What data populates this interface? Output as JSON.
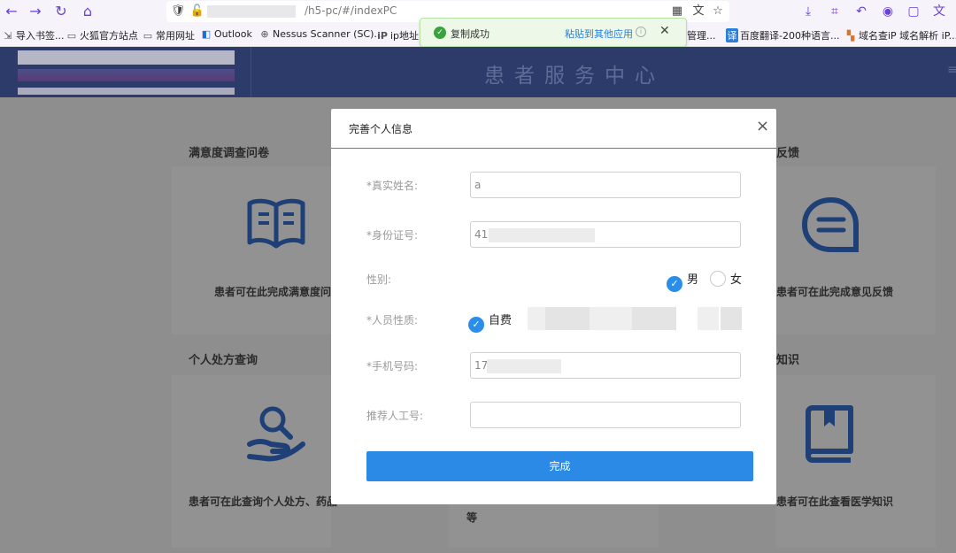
{
  "browser": {
    "url_path": "/h5-pc/#/indexPC",
    "bookmarks": [
      "导入书签...",
      "火狐官方站点",
      "常用网址",
      "Outlook",
      "Nessus Scanner (SC)...",
      "ip地址",
      "管理...",
      "百度翻译-200种语言...",
      "域名查iP 域名解析 iP..."
    ]
  },
  "toast": {
    "message": "复制成功",
    "link": "粘贴到其他应用",
    "close": "✕"
  },
  "header": {
    "title": "患者服务中心"
  },
  "sections": [
    {
      "title": "满意度调查问卷",
      "card_text": "患者可在此完成满意度问卷"
    },
    {
      "title": "反馈",
      "card_text": "患者可在此完成意见反馈"
    },
    {
      "title": "个人处方查询",
      "card_text": "患者可在此查询个人处方、药品"
    },
    {
      "title": "知识",
      "card_text": "患者可在此查看医学知识"
    },
    {
      "title": "",
      "card_text": "等"
    }
  ],
  "modal": {
    "title": "完善个人信息",
    "close": "×",
    "fields": {
      "name": {
        "label": "*真实姓名:",
        "value": "a"
      },
      "id_number": {
        "label": "*身份证号:",
        "value": "41"
      },
      "gender": {
        "label": "性别:",
        "options": [
          "男",
          "女"
        ],
        "selected": "男"
      },
      "person_type": {
        "label": "*人员性质:",
        "options": [
          "自费"
        ],
        "selected": "自费"
      },
      "phone": {
        "label": "*手机号码:",
        "value": "17"
      },
      "referrer": {
        "label": "推荐人工号:",
        "value": ""
      }
    },
    "submit_label": "完成"
  },
  "colors": {
    "primary": "#2b8ae6",
    "header_bg": "#2c3b69",
    "toast_bg": "#eef8e9"
  }
}
